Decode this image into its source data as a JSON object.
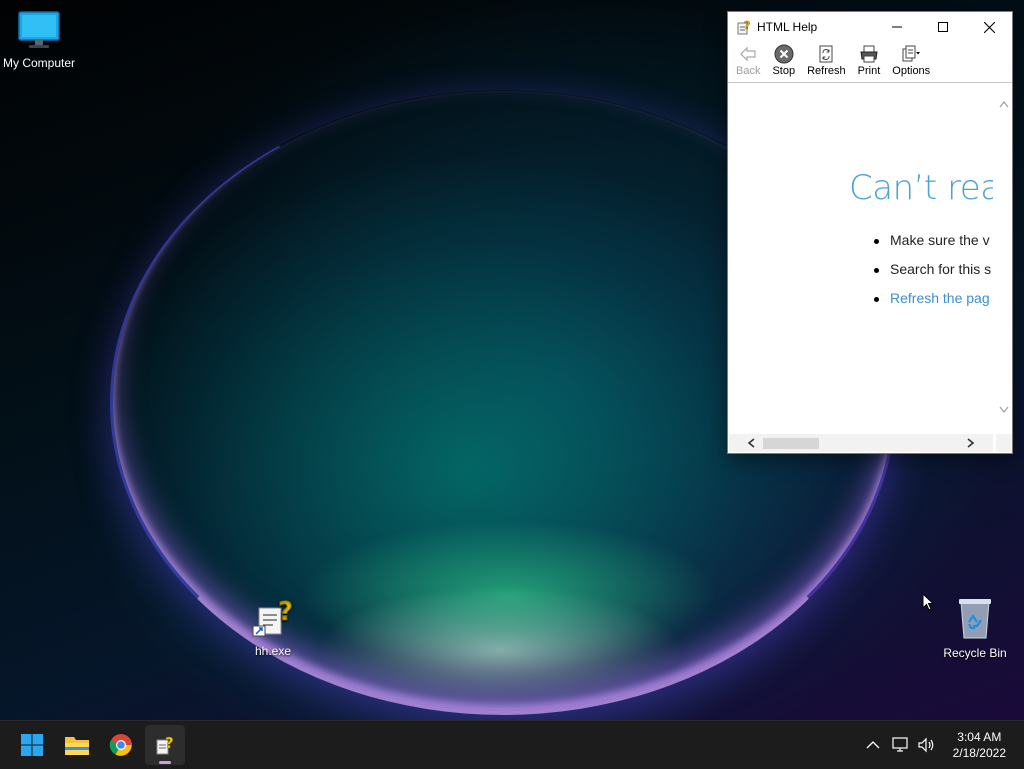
{
  "desktop": {
    "icons": [
      {
        "label": "My Computer",
        "icon": "monitor-icon"
      },
      {
        "label": "hh.exe",
        "icon": "help-shortcut-icon"
      },
      {
        "label": "Recycle Bin",
        "icon": "recycle-bin-icon"
      }
    ]
  },
  "window": {
    "title": "HTML Help",
    "toolbar": {
      "back": "Back",
      "stop": "Stop",
      "refresh": "Refresh",
      "print": "Print",
      "options": "Options"
    },
    "content": {
      "heading": "Can’t reac",
      "bullets": [
        "Make sure the v",
        "Search for this s"
      ],
      "link": "Refresh the pag"
    }
  },
  "taskbar": {
    "pinned": [
      "start-icon",
      "file-explorer-icon",
      "chrome-icon",
      "html-help-icon"
    ],
    "clock": {
      "time": "3:04 AM",
      "date": "2/18/2022"
    }
  },
  "colors": {
    "accent": "#4aa2d8",
    "taskbar": "#1c1c1c"
  }
}
